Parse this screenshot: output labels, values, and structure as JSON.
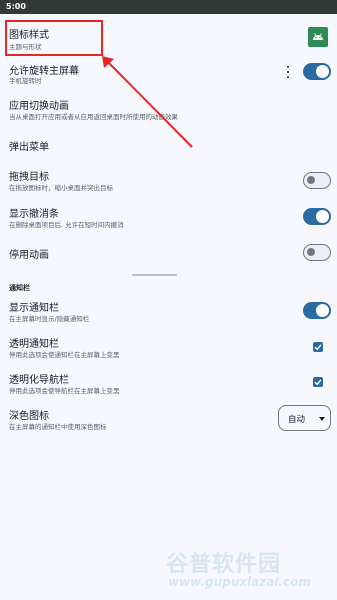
{
  "status_bar": {
    "time": "5:00"
  },
  "colors": {
    "accent": "#2b6aa3",
    "annotation": "#e8262a",
    "status_bar": "#2e3a33",
    "app_icon": "#2e8b57"
  },
  "settings": {
    "icon_style": {
      "title": "图标样式",
      "subtitle": "主题与形状"
    },
    "allow_rotate": {
      "title": "允许旋转主屏幕",
      "subtitle": "手机旋转时",
      "enabled": true
    },
    "app_switch_anim": {
      "title": "应用切换动画",
      "subtitle": "当从桌面打开应用或者从应用返回桌面时所使用的动画效果"
    },
    "popup_menu": {
      "title": "弹出菜单"
    },
    "drag_target": {
      "title": "拖拽目标",
      "subtitle": "在拖放图标时，缩小桌面并突出目标",
      "enabled": false
    },
    "show_undo": {
      "title": "显示撤消条",
      "subtitle": "在删除桌面项目后, 允许在短时间内撤消",
      "enabled": true
    },
    "disable_anim": {
      "title": "停用动画",
      "enabled": false
    }
  },
  "notification_section": {
    "header": "通知栏",
    "show_bar": {
      "title": "显示通知栏",
      "subtitle": "在主屏幕时显示/隐藏通知栏",
      "enabled": true
    },
    "transparent_bar": {
      "title": "透明通知栏",
      "subtitle": "停用此选项会使通知栏在主屏幕上变黑",
      "checked": true
    },
    "transparent_nav": {
      "title": "透明化导航栏",
      "subtitle": "停用此选项会使导航栏在主屏幕上变黑",
      "checked": true
    },
    "dark_icons": {
      "title": "深色图标",
      "subtitle": "在主屏幕的通知栏中使用深色图标",
      "selected": "自动",
      "options": [
        "自动"
      ]
    }
  },
  "watermark": {
    "text": "谷普软件园",
    "url": "www.gupuxlazal.com"
  }
}
